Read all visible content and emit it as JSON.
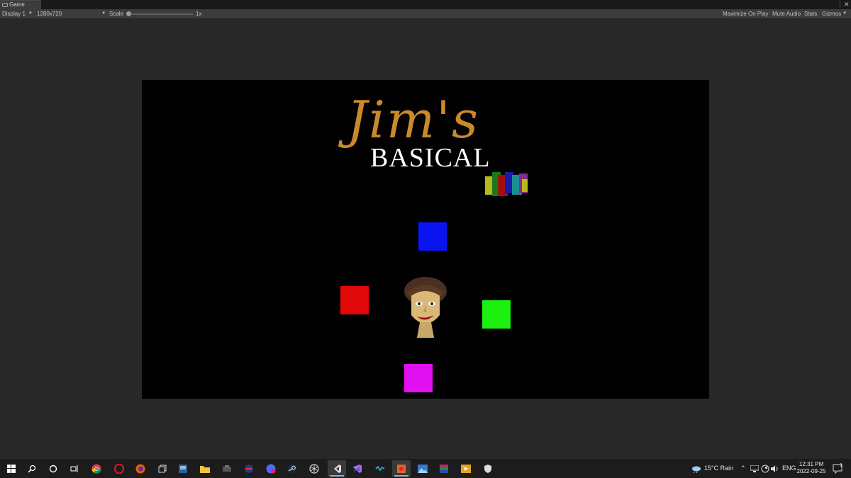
{
  "tab": {
    "title": "Game"
  },
  "toolbar": {
    "display": "Display 1",
    "resolution": "1280x720",
    "scale_label": "Scale",
    "scale_value": "1x",
    "maximize": "Maximize On Play",
    "mute": "Mute Audio",
    "stats": "Stats",
    "gizmos": "Gizmos"
  },
  "game": {
    "title_top": "Jim's",
    "title_bottom": "BASICAL",
    "colors": {
      "title": "#c98a2a",
      "blue": "#0a14f0",
      "red": "#e00808",
      "green": "#1cf010",
      "magenta": "#e010f0"
    }
  },
  "taskbar": {
    "icons": [
      "windows-start-icon",
      "search-icon",
      "cortana-icon",
      "task-view-icon",
      "chrome-icon",
      "opera-icon",
      "firefox-icon",
      "multitask-icon",
      "app-icon",
      "file-explorer-icon",
      "app-icon",
      "app-icon",
      "chat-app-icon",
      "steam-icon",
      "unity-icon",
      "visual-studio-code-icon",
      "visual-studio-icon",
      "app-icon",
      "paint-app-icon",
      "photos-icon",
      "winrar-icon",
      "media-player-icon",
      "security-icon"
    ],
    "weather": "15°C  Rain",
    "language": "ENG",
    "time": "12:31 PM",
    "date": "2022-09-25",
    "notification_count": "1"
  }
}
